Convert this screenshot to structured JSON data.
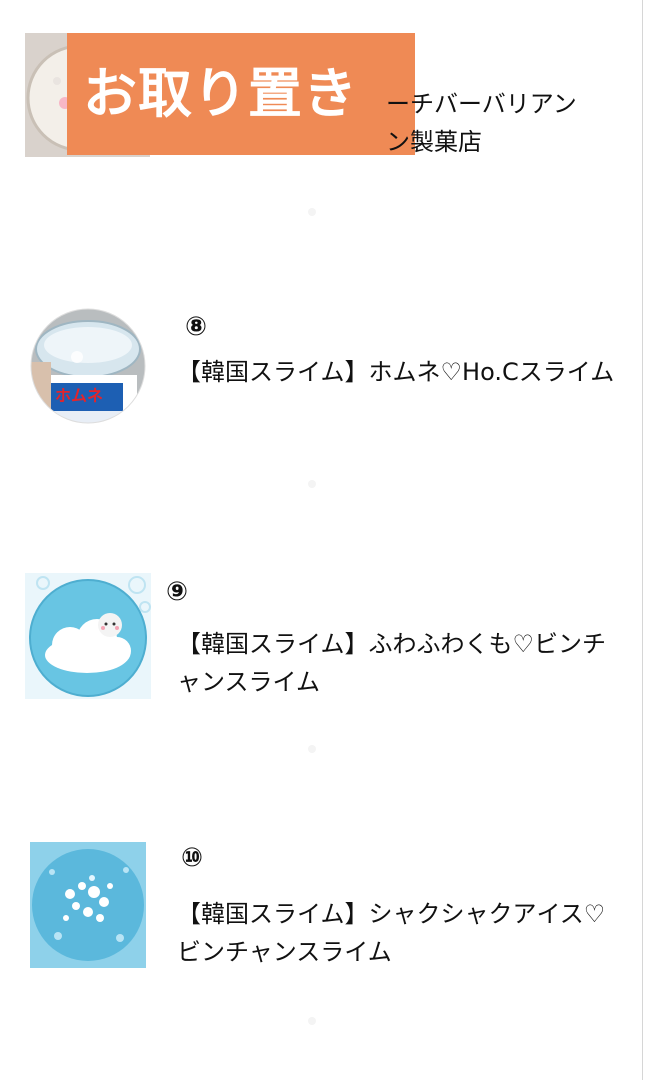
{
  "items": [
    {
      "title_partial": "ーチバーバリアン\nン製菓店",
      "badge": "お取り置き"
    },
    {
      "number": "⑧",
      "title": "【韓国スライム】ホムネ♡Ho.Cスライム",
      "label_on_jar": "ホムネ"
    },
    {
      "number": "⑨",
      "title": "【韓国スライム】ふわふわくも♡ビンチャンスライム"
    },
    {
      "number": "⑩",
      "title": "【韓国スライム】シャクシャクアイス♡ビンチャンスライム"
    }
  ],
  "colors": {
    "badge": "#ef8a55",
    "slime_blue": "#68c5e3",
    "sky_blue": "#8ed1ea"
  },
  "icons": {
    "item1": "slime-jar-image",
    "item8": "homune-slime-jar-image",
    "item9": "cloud-slime-image",
    "item10": "ice-slime-image"
  }
}
